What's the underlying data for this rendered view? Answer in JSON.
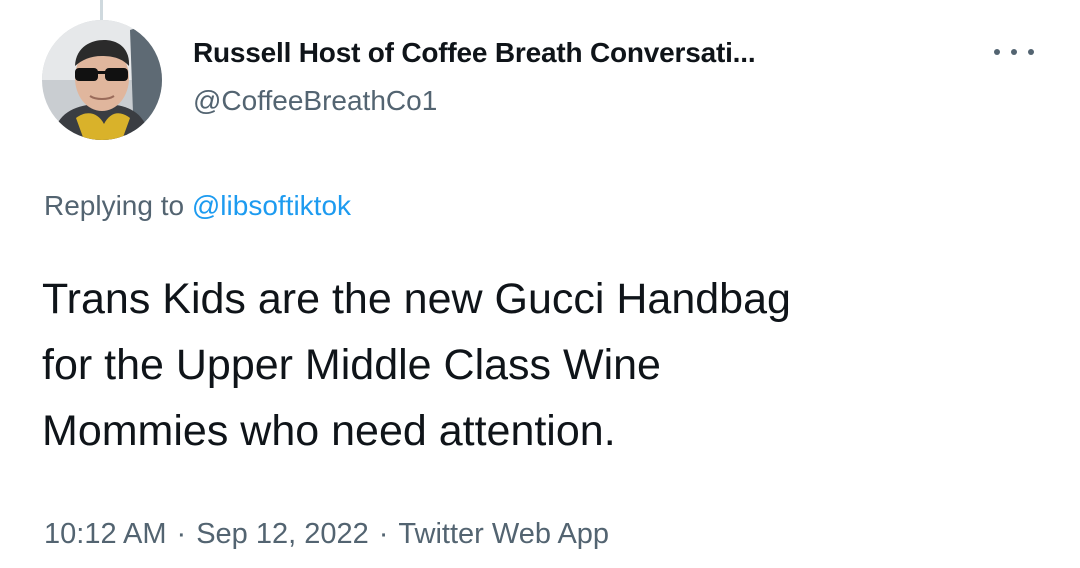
{
  "author": {
    "display_name": "Russell Host of Coffee Breath Conversati...",
    "handle": "@CoffeeBreathCo1",
    "avatar": "profile-photo"
  },
  "more_icon": "more-horizontal-icon",
  "reply": {
    "prefix": "Replying to",
    "handle": "@libsoftiktok"
  },
  "tweet": {
    "lines": [
      "Trans Kids are the new Gucci Handbag",
      "for the Upper Middle Class Wine",
      "Mommies who need attention."
    ]
  },
  "meta": {
    "time": "10:12 AM",
    "separator": "·",
    "date": "Sep 12, 2022",
    "source": "Twitter Web App"
  },
  "colors": {
    "link": "#1d9bf0",
    "secondary_text": "#536471",
    "primary_text": "#0f1419"
  }
}
